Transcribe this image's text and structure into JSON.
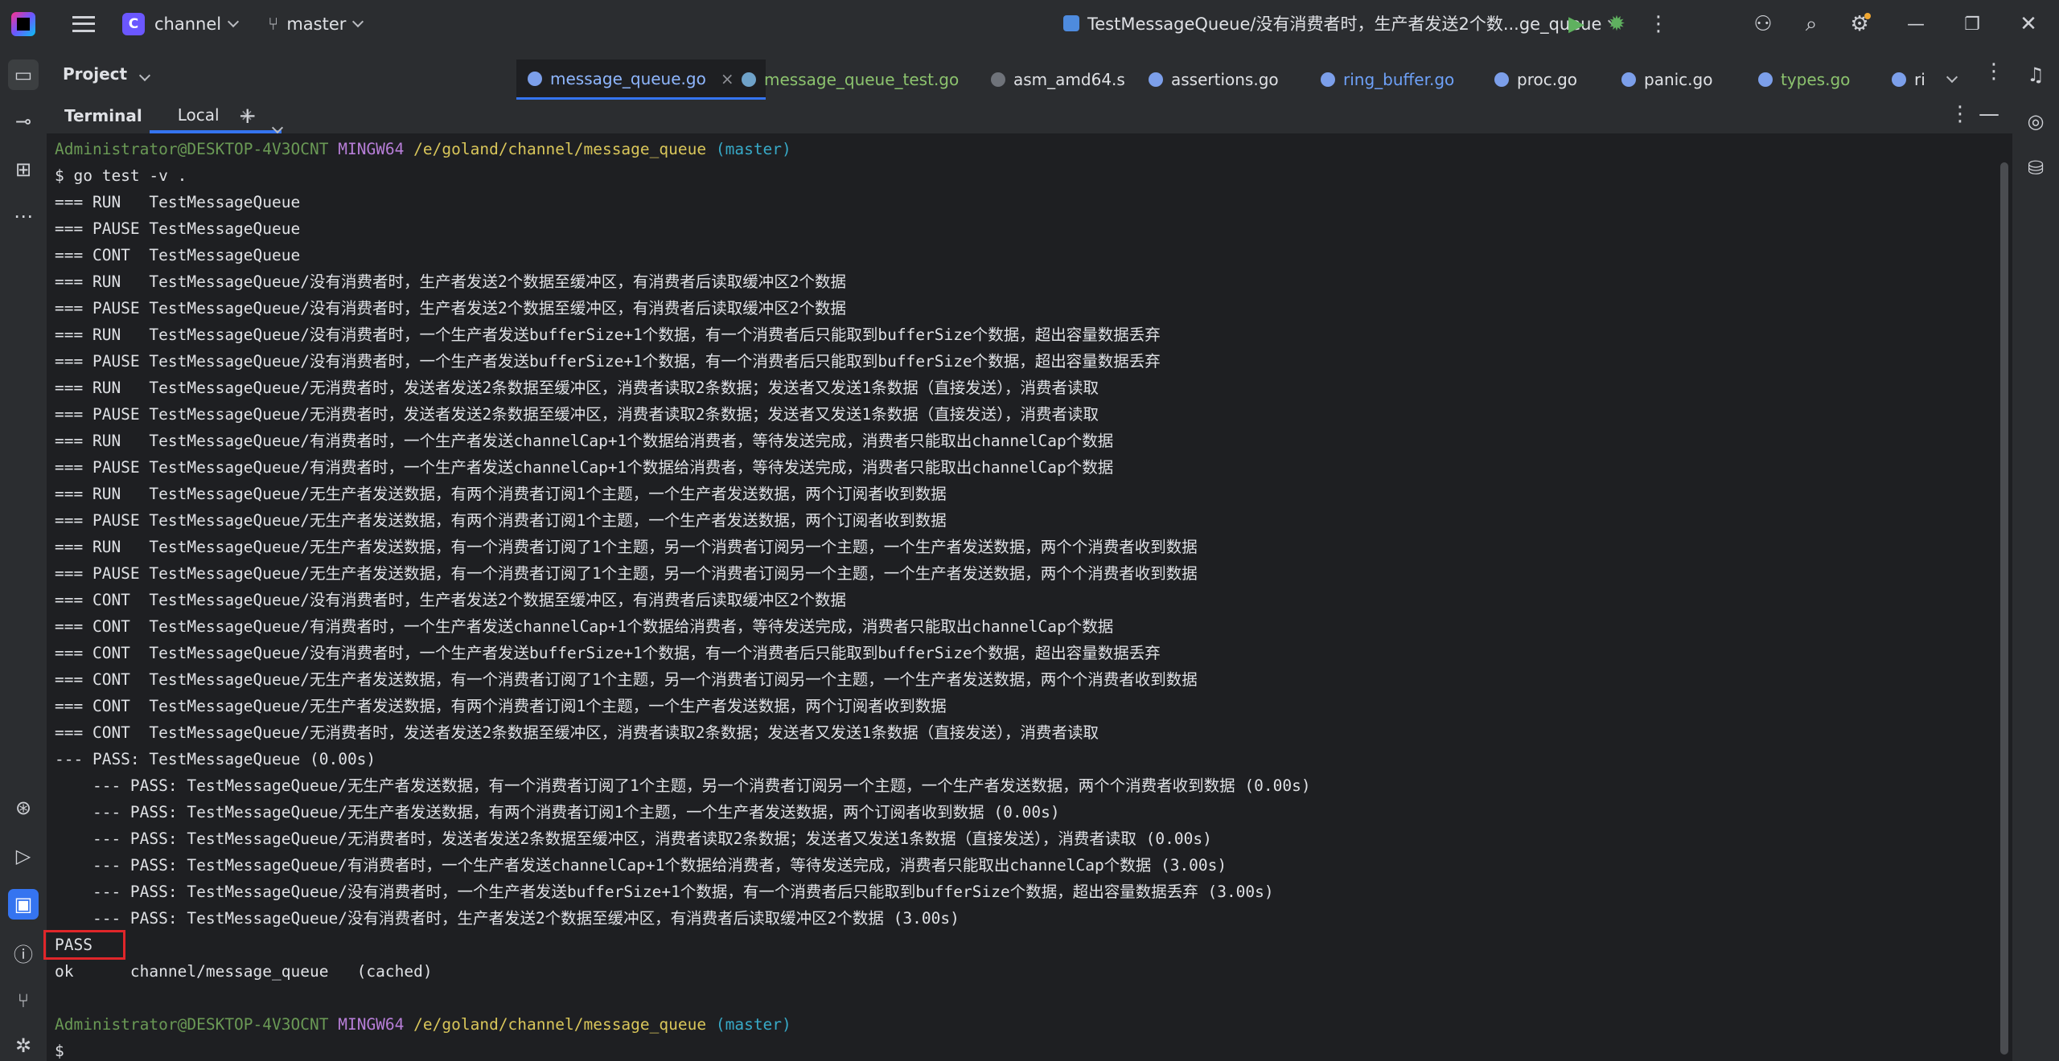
{
  "titlebar": {
    "project_name": "channel",
    "project_badge": "C",
    "branch": "master",
    "run_config": "TestMessageQueue/没有消费者时，生产者发送2个数...ge_queue"
  },
  "tabs_panel": {
    "project_label": "Project",
    "tabs": [
      {
        "label": "message_queue.go"
      },
      {
        "label": "message_queue_test.go"
      },
      {
        "label": "asm_amd64.s"
      },
      {
        "label": "assertions.go"
      },
      {
        "label": "ring_buffer.go"
      },
      {
        "label": "proc.go"
      },
      {
        "label": "panic.go"
      },
      {
        "label": "types.go"
      },
      {
        "label": "ri"
      }
    ]
  },
  "terminal": {
    "title": "Terminal",
    "tab_label": "Local",
    "prompt": {
      "user": "Administrator@DESKTOP-4V3OCNT",
      "host": "MINGW64",
      "path": "/e/goland/channel/message_queue",
      "branch": "(master)"
    },
    "lines": [
      "$ go test -v .",
      "=== RUN   TestMessageQueue",
      "=== PAUSE TestMessageQueue",
      "=== CONT  TestMessageQueue",
      "=== RUN   TestMessageQueue/没有消费者时，生产者发送2个数据至缓冲区，有消费者后读取缓冲区2个数据",
      "=== PAUSE TestMessageQueue/没有消费者时，生产者发送2个数据至缓冲区，有消费者后读取缓冲区2个数据",
      "=== RUN   TestMessageQueue/没有消费者时，一个生产者发送bufferSize+1个数据，有一个消费者后只能取到bufferSize个数据，超出容量数据丢弃",
      "=== PAUSE TestMessageQueue/没有消费者时，一个生产者发送bufferSize+1个数据，有一个消费者后只能取到bufferSize个数据，超出容量数据丢弃",
      "=== RUN   TestMessageQueue/无消费者时，发送者发送2条数据至缓冲区，消费者读取2条数据；发送者又发送1条数据（直接发送），消费者读取",
      "=== PAUSE TestMessageQueue/无消费者时，发送者发送2条数据至缓冲区，消费者读取2条数据；发送者又发送1条数据（直接发送），消费者读取",
      "=== RUN   TestMessageQueue/有消费者时，一个生产者发送channelCap+1个数据给消费者，等待发送完成，消费者只能取出channelCap个数据",
      "=== PAUSE TestMessageQueue/有消费者时，一个生产者发送channelCap+1个数据给消费者，等待发送完成，消费者只能取出channelCap个数据",
      "=== RUN   TestMessageQueue/无生产者发送数据，有两个消费者订阅1个主题，一个生产者发送数据，两个订阅者收到数据",
      "=== PAUSE TestMessageQueue/无生产者发送数据，有两个消费者订阅1个主题，一个生产者发送数据，两个订阅者收到数据",
      "=== RUN   TestMessageQueue/无生产者发送数据，有一个消费者订阅了1个主题，另一个消费者订阅另一个主题，一个生产者发送数据，两个个消费者收到数据",
      "=== PAUSE TestMessageQueue/无生产者发送数据，有一个消费者订阅了1个主题，另一个消费者订阅另一个主题，一个生产者发送数据，两个个消费者收到数据",
      "=== CONT  TestMessageQueue/没有消费者时，生产者发送2个数据至缓冲区，有消费者后读取缓冲区2个数据",
      "=== CONT  TestMessageQueue/有消费者时，一个生产者发送channelCap+1个数据给消费者，等待发送完成，消费者只能取出channelCap个数据",
      "=== CONT  TestMessageQueue/没有消费者时，一个生产者发送bufferSize+1个数据，有一个消费者后只能取到bufferSize个数据，超出容量数据丢弃",
      "=== CONT  TestMessageQueue/无生产者发送数据，有一个消费者订阅了1个主题，另一个消费者订阅另一个主题，一个生产者发送数据，两个个消费者收到数据",
      "=== CONT  TestMessageQueue/无生产者发送数据，有两个消费者订阅1个主题，一个生产者发送数据，两个订阅者收到数据",
      "=== CONT  TestMessageQueue/无消费者时，发送者发送2条数据至缓冲区，消费者读取2条数据；发送者又发送1条数据（直接发送），消费者读取",
      "--- PASS: TestMessageQueue (0.00s)",
      "    --- PASS: TestMessageQueue/无生产者发送数据，有一个消费者订阅了1个主题，另一个消费者订阅另一个主题，一个生产者发送数据，两个个消费者收到数据 (0.00s)",
      "    --- PASS: TestMessageQueue/无生产者发送数据，有两个消费者订阅1个主题，一个生产者发送数据，两个订阅者收到数据 (0.00s)",
      "    --- PASS: TestMessageQueue/无消费者时，发送者发送2条数据至缓冲区，消费者读取2条数据；发送者又发送1条数据（直接发送），消费者读取 (0.00s)",
      "    --- PASS: TestMessageQueue/有消费者时，一个生产者发送channelCap+1个数据给消费者，等待发送完成，消费者只能取出channelCap个数据 (3.00s)",
      "    --- PASS: TestMessageQueue/没有消费者时，一个生产者发送bufferSize+1个数据，有一个消费者后只能取到bufferSize个数据，超出容量数据丢弃 (3.00s)",
      "    --- PASS: TestMessageQueue/没有消费者时，生产者发送2个数据至缓冲区，有消费者后读取缓冲区2个数据 (3.00s)",
      "PASS",
      "ok      channel/message_queue   (cached)",
      ""
    ],
    "final_prompt": "$"
  },
  "colors": {
    "accent": "#3574f0",
    "highlight_box": "#e0262a",
    "prompt_user": "#6a9955",
    "prompt_host": "#b77ed8",
    "prompt_path": "#d9c65a",
    "prompt_branch": "#37a9c7"
  },
  "icons": [
    "app-logo-icon",
    "hamburger-icon",
    "branch-icon",
    "run-icon",
    "debug-icon",
    "more-icon",
    "add-user-icon",
    "search-icon",
    "settings-icon",
    "minimize-icon",
    "restore-icon",
    "close-icon",
    "folder-icon",
    "commit-icon",
    "structure-icon",
    "services-icon",
    "run-tool-icon",
    "terminal-icon",
    "problems-icon",
    "git-icon",
    "notifications-icon",
    "ai-icon",
    "database-icon"
  ]
}
